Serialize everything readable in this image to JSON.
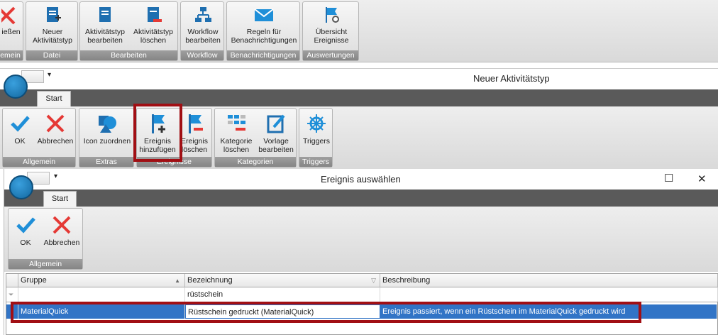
{
  "top_ribbon": {
    "buttons": [
      {
        "id": "close",
        "label1": "ießen",
        "label2": ""
      },
      {
        "id": "new_type",
        "label1": "Neuer",
        "label2": "Aktivitätstyp"
      },
      {
        "id": "edit_type",
        "label1": "Aktivitätstyp",
        "label2": "bearbeiten"
      },
      {
        "id": "delete_type",
        "label1": "Aktivitätstyp",
        "label2": "löschen"
      },
      {
        "id": "edit_workflow",
        "label1": "Workflow",
        "label2": "bearbeiten"
      },
      {
        "id": "rules",
        "label1": "Regeln für",
        "label2": "Benachrichtigungen"
      },
      {
        "id": "overview",
        "label1": "Übersicht",
        "label2": "Ereignisse"
      }
    ],
    "groups": [
      "emein",
      "Datei",
      "Bearbeiten",
      "Workflow",
      "Benachrichtigungen",
      "Auswertungen"
    ]
  },
  "window1": {
    "title": "Neuer Aktivitätstyp",
    "qat_arrow": "▾",
    "tab": "Start",
    "buttons": {
      "ok": "OK",
      "cancel": "Abbrechen",
      "icon": "Icon zuordnen",
      "add_event_1": "Ereignis",
      "add_event_2": "hinzufügen",
      "del_event_1": "Ereignis",
      "del_event_2": "löschen",
      "del_cat_1": "Kategorie",
      "del_cat_2": "löschen",
      "tmpl_1": "Vorlage",
      "tmpl_2": "bearbeiten",
      "triggers": "Triggers"
    },
    "groups": {
      "general": "Allgemein",
      "extras": "Extras",
      "events": "Ereignisse",
      "categories": "Kategorien",
      "triggers": "Triggers"
    }
  },
  "window2": {
    "title": "Ereignis auswählen",
    "qat_arrow": "▾",
    "tab": "Start",
    "ok": "OK",
    "cancel": "Abbrechen",
    "group": "Allgemein",
    "controls": {
      "maximize": "☐",
      "close": "✕"
    }
  },
  "grid": {
    "columns": [
      "Gruppe",
      "Bezeichnung",
      "Beschreibung"
    ],
    "filter_value": "rüstschein",
    "rows": [
      {
        "gruppe": "MaterialQuick",
        "bezeichnung": "Rüstschein gedruckt (MaterialQuick)",
        "beschreibung": "Ereignis passiert, wenn ein Rüstschein im MaterialQuick gedruckt wird"
      }
    ]
  },
  "colors": {
    "accent_blue": "#1f8fd8",
    "highlight_red": "#a10f14",
    "selection": "#3174c6"
  }
}
